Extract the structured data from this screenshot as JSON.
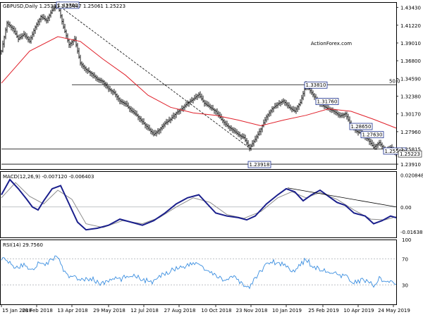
{
  "chart_data": [
    {
      "type": "candlestick",
      "symbol": "GBPUSD,Daily",
      "ohlc": {
        "open": "1.25331",
        "high": "1.25447",
        "low": "1.25061",
        "close": "1.25223"
      },
      "y_ticks": [
        "1.43430",
        "1.41220",
        "1.39010",
        "1.36800",
        "1.34590",
        "1.32380",
        "1.30170",
        "1.27960",
        "1.25815",
        "1.23910"
      ],
      "ylim": [
        1.233,
        1.441
      ],
      "current_price": "1.25223",
      "watermark": "ActionForex.com",
      "series": [
        {
          "name": "price",
          "points": [
            [
              0,
              1.38
            ],
            [
              4,
              1.415
            ],
            [
              8,
              1.408
            ],
            [
              12,
              1.395
            ],
            [
              16,
              1.401
            ],
            [
              20,
              1.392
            ],
            [
              24,
              1.41
            ],
            [
              28,
              1.423
            ],
            [
              32,
              1.418
            ],
            [
              36,
              1.431
            ],
            [
              40,
              1.4376
            ],
            [
              44,
              1.41
            ],
            [
              48,
              1.388
            ],
            [
              52,
              1.395
            ],
            [
              56,
              1.365
            ],
            [
              60,
              1.357
            ],
            [
              64,
              1.352
            ],
            [
              68,
              1.345
            ],
            [
              72,
              1.342
            ],
            [
              76,
              1.333
            ],
            [
              80,
              1.328
            ],
            [
              84,
              1.318
            ],
            [
              88,
              1.314
            ],
            [
              92,
              1.306
            ],
            [
              96,
              1.3
            ],
            [
              100,
              1.292
            ],
            [
              104,
              1.284
            ],
            [
              108,
              1.276
            ],
            [
              112,
              1.282
            ],
            [
              116,
              1.29
            ],
            [
              120,
              1.295
            ],
            [
              124,
              1.303
            ],
            [
              128,
              1.308
            ],
            [
              132,
              1.315
            ],
            [
              136,
              1.32
            ],
            [
              140,
              1.326
            ],
            [
              144,
              1.315
            ],
            [
              148,
              1.31
            ],
            [
              152,
              1.305
            ],
            [
              156,
              1.295
            ],
            [
              160,
              1.287
            ],
            [
              164,
              1.282
            ],
            [
              168,
              1.276
            ],
            [
              172,
              1.272
            ],
            [
              176,
              1.2591
            ],
            [
              180,
              1.27
            ],
            [
              184,
              1.283
            ],
            [
              188,
              1.298
            ],
            [
              192,
              1.308
            ],
            [
              196,
              1.314
            ],
            [
              200,
              1.318
            ],
            [
              204,
              1.31
            ],
            [
              208,
              1.305
            ],
            [
              212,
              1.316
            ],
            [
              216,
              1.3381
            ],
            [
              220,
              1.328
            ],
            [
              224,
              1.3176
            ],
            [
              228,
              1.312
            ],
            [
              232,
              1.308
            ],
            [
              236,
              1.305
            ],
            [
              240,
              1.299
            ],
            [
              244,
              1.302
            ],
            [
              248,
              1.2865
            ],
            [
              252,
              1.28
            ],
            [
              256,
              1.2763
            ],
            [
              260,
              1.27
            ],
            [
              264,
              1.26
            ],
            [
              268,
              1.266
            ],
            [
              272,
              1.2559
            ],
            [
              276,
              1.26
            ],
            [
              280,
              1.2522
            ]
          ]
        },
        {
          "name": "ma",
          "points": [
            [
              0,
              1.34
            ],
            [
              20,
              1.38
            ],
            [
              40,
              1.398
            ],
            [
              56,
              1.392
            ],
            [
              72,
              1.37
            ],
            [
              88,
              1.35
            ],
            [
              104,
              1.325
            ],
            [
              120,
              1.31
            ],
            [
              136,
              1.303
            ],
            [
              152,
              1.3
            ],
            [
              168,
              1.294
            ],
            [
              184,
              1.287
            ],
            [
              200,
              1.294
            ],
            [
              216,
              1.3
            ],
            [
              232,
              1.308
            ],
            [
              248,
              1.305
            ],
            [
              264,
              1.295
            ],
            [
              280,
              1.284
            ]
          ]
        }
      ],
      "annotations": [
        {
          "text": "1.43760",
          "i": 40,
          "y": 1.4376
        },
        {
          "text": "1.33810",
          "i": 216,
          "y": 1.3381
        },
        {
          "text": "1.31760",
          "i": 224,
          "y": 1.3176
        },
        {
          "text": "1.28650",
          "i": 248,
          "y": 1.2865
        },
        {
          "text": "1.27630",
          "i": 256,
          "y": 1.2763
        },
        {
          "text": "1.25590",
          "i": 272,
          "y": 1.2559
        },
        {
          "text": "1.23918",
          "i": 176,
          "y": 1.2391
        }
      ],
      "fib_label": "50.0",
      "hlines": [
        {
          "y": 1.3381,
          "from_i": 50,
          "to_i": 280
        },
        {
          "y": 1.258,
          "from_i": 0,
          "to_i": 280
        },
        {
          "y": 1.2391,
          "from_i": 0,
          "to_i": 280
        }
      ],
      "dashed_line": {
        "from": [
          40,
          1.4376
        ],
        "to": [
          176,
          1.2591
        ]
      }
    },
    {
      "type": "line",
      "label": "MACD(12,26,9) -0.007120 -0.006403",
      "y_ticks": [
        "0.020848",
        "0.00",
        "-0.016389"
      ],
      "ylim": [
        -0.02,
        0.0235
      ],
      "zero": 0.0,
      "series": [
        {
          "name": "macd",
          "points": [
            [
              0,
              0.008
            ],
            [
              6,
              0.018
            ],
            [
              12,
              0.012
            ],
            [
              18,
              0.005
            ],
            [
              22,
              0.0
            ],
            [
              26,
              -0.002
            ],
            [
              30,
              0.004
            ],
            [
              36,
              0.012
            ],
            [
              42,
              0.014
            ],
            [
              48,
              0.002
            ],
            [
              54,
              -0.01
            ],
            [
              60,
              -0.015
            ],
            [
              68,
              -0.014
            ],
            [
              76,
              -0.012
            ],
            [
              84,
              -0.008
            ],
            [
              92,
              -0.01
            ],
            [
              100,
              -0.012
            ],
            [
              108,
              -0.009
            ],
            [
              116,
              -0.004
            ],
            [
              124,
              0.002
            ],
            [
              132,
              0.006
            ],
            [
              140,
              0.008
            ],
            [
              146,
              0.002
            ],
            [
              152,
              -0.004
            ],
            [
              160,
              -0.006
            ],
            [
              168,
              -0.007
            ],
            [
              174,
              -0.0085
            ],
            [
              180,
              -0.006
            ],
            [
              188,
              0.002
            ],
            [
              196,
              0.008
            ],
            [
              202,
              0.012
            ],
            [
              208,
              0.01
            ],
            [
              214,
              0.004
            ],
            [
              220,
              0.008
            ],
            [
              226,
              0.011
            ],
            [
              232,
              0.007
            ],
            [
              238,
              0.003
            ],
            [
              244,
              0.001
            ],
            [
              250,
              -0.004
            ],
            [
              258,
              -0.006
            ],
            [
              264,
              -0.011
            ],
            [
              270,
              -0.009
            ],
            [
              276,
              -0.006
            ],
            [
              280,
              -0.0071
            ]
          ]
        },
        {
          "name": "signal",
          "points": [
            [
              0,
              0.006
            ],
            [
              10,
              0.016
            ],
            [
              20,
              0.007
            ],
            [
              30,
              0.002
            ],
            [
              40,
              0.011
            ],
            [
              50,
              0.005
            ],
            [
              60,
              -0.011
            ],
            [
              72,
              -0.0135
            ],
            [
              86,
              -0.009
            ],
            [
              100,
              -0.011
            ],
            [
              112,
              -0.007
            ],
            [
              124,
              0.0
            ],
            [
              136,
              0.006
            ],
            [
              148,
              0.003
            ],
            [
              160,
              -0.005
            ],
            [
              172,
              -0.0075
            ],
            [
              184,
              -0.003
            ],
            [
              196,
              0.006
            ],
            [
              206,
              0.01
            ],
            [
              216,
              0.006
            ],
            [
              226,
              0.0095
            ],
            [
              238,
              0.005
            ],
            [
              250,
              -0.002
            ],
            [
              262,
              -0.008
            ],
            [
              272,
              -0.0085
            ],
            [
              280,
              -0.0064
            ]
          ]
        }
      ],
      "trendline": {
        "from": [
          203,
          0.0125
        ],
        "to": [
          280,
          0.0
        ]
      }
    },
    {
      "type": "line",
      "label": "RSI(14) 29.7560",
      "y_ticks": [
        "100",
        "70",
        "30",
        "0"
      ],
      "ylim": [
        0,
        100
      ],
      "levels": [
        70,
        30
      ],
      "series": [
        {
          "name": "rsi",
          "points": [
            [
              0,
              72
            ],
            [
              4,
              66
            ],
            [
              8,
              60
            ],
            [
              12,
              56
            ],
            [
              16,
              62
            ],
            [
              20,
              54
            ],
            [
              24,
              58
            ],
            [
              28,
              66
            ],
            [
              32,
              62
            ],
            [
              36,
              70
            ],
            [
              40,
              74
            ],
            [
              44,
              52
            ],
            [
              48,
              40
            ],
            [
              52,
              46
            ],
            [
              56,
              36
            ],
            [
              60,
              38
            ],
            [
              64,
              40
            ],
            [
              68,
              34
            ],
            [
              72,
              32
            ],
            [
              76,
              36
            ],
            [
              80,
              40
            ],
            [
              84,
              38
            ],
            [
              88,
              42
            ],
            [
              92,
              46
            ],
            [
              96,
              44
            ],
            [
              100,
              38
            ],
            [
              104,
              36
            ],
            [
              108,
              34
            ],
            [
              112,
              42
            ],
            [
              116,
              48
            ],
            [
              120,
              52
            ],
            [
              124,
              56
            ],
            [
              128,
              58
            ],
            [
              132,
              60
            ],
            [
              136,
              62
            ],
            [
              140,
              64
            ],
            [
              144,
              54
            ],
            [
              148,
              48
            ],
            [
              152,
              44
            ],
            [
              156,
              40
            ],
            [
              160,
              38
            ],
            [
              164,
              42
            ],
            [
              168,
              36
            ],
            [
              172,
              30
            ],
            [
              176,
              26
            ],
            [
              180,
              40
            ],
            [
              184,
              52
            ],
            [
              188,
              62
            ],
            [
              192,
              66
            ],
            [
              196,
              64
            ],
            [
              200,
              62
            ],
            [
              204,
              56
            ],
            [
              208,
              52
            ],
            [
              212,
              60
            ],
            [
              216,
              70
            ],
            [
              220,
              60
            ],
            [
              224,
              56
            ],
            [
              228,
              52
            ],
            [
              232,
              50
            ],
            [
              236,
              48
            ],
            [
              240,
              42
            ],
            [
              244,
              44
            ],
            [
              248,
              36
            ],
            [
              252,
              34
            ],
            [
              256,
              38
            ],
            [
              260,
              34
            ],
            [
              264,
              30
            ],
            [
              268,
              40
            ],
            [
              272,
              32
            ],
            [
              276,
              36
            ],
            [
              280,
              30
            ]
          ]
        }
      ]
    }
  ],
  "x_axis": {
    "labels": [
      "15 Jan 2018",
      "28 Feb 2018",
      "13 Apr 2018",
      "29 May 2018",
      "12 Jul 2018",
      "27 Aug 2018",
      "10 Oct 2018",
      "23 Nov 2018",
      "10 Jan 2019",
      "25 Feb 2019",
      "10 Apr 2019",
      "24 May 2019"
    ],
    "positions": [
      0,
      25,
      50,
      76,
      101,
      126,
      152,
      177,
      202,
      228,
      253,
      278
    ],
    "max_index": 280
  }
}
